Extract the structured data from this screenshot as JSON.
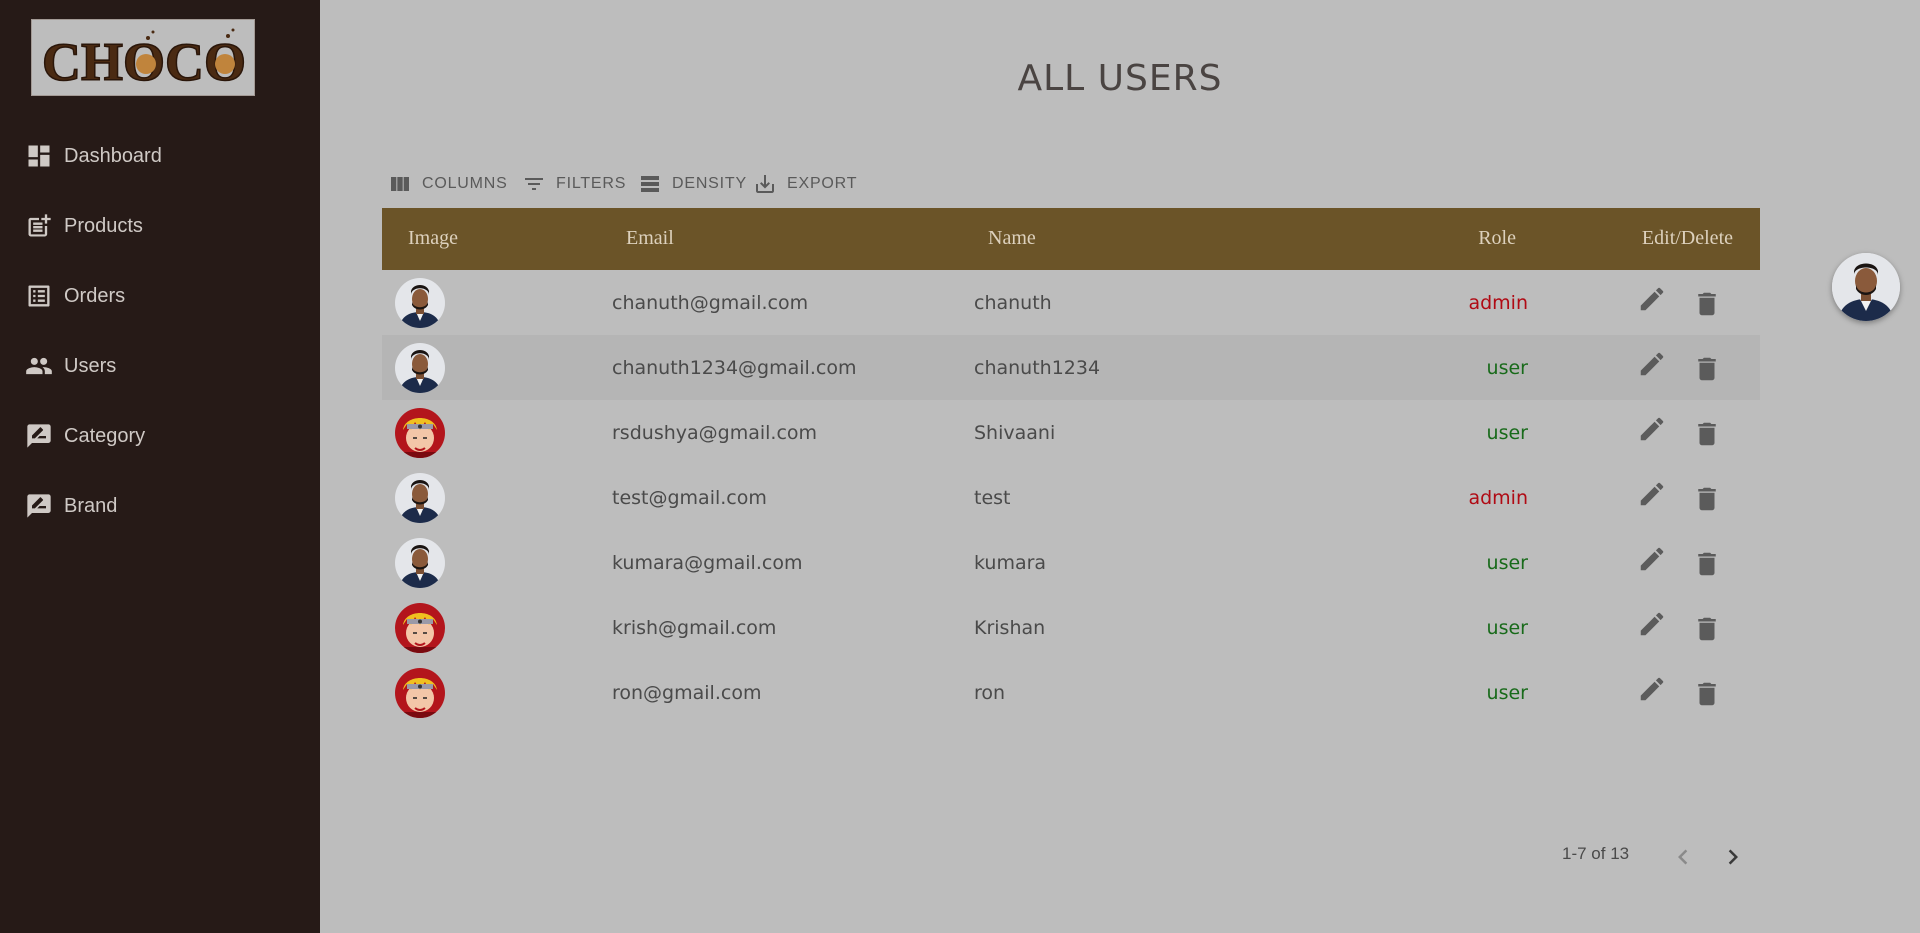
{
  "brand": {
    "logo_text": "CHOCO"
  },
  "sidebar": {
    "items": [
      {
        "label": "Dashboard",
        "icon": "dashboard-icon"
      },
      {
        "label": "Products",
        "icon": "post-add-icon"
      },
      {
        "label": "Orders",
        "icon": "list-alt-icon"
      },
      {
        "label": "Users",
        "icon": "people-icon"
      },
      {
        "label": "Category",
        "icon": "rate-review-icon"
      },
      {
        "label": "Brand",
        "icon": "rate-review-icon"
      }
    ]
  },
  "page": {
    "title": "ALL USERS"
  },
  "toolbar": {
    "columns": "COLUMNS",
    "filters": "FILTERS",
    "density": "DENSITY",
    "export": "EXPORT"
  },
  "grid": {
    "headers": {
      "image": "Image",
      "email": "Email",
      "name": "Name",
      "role": "Role",
      "actions": "Edit/Delete"
    },
    "rows": [
      {
        "avatar": "man-avatar",
        "email": "chanuth@gmail.com",
        "name": "chanuth",
        "role": "admin"
      },
      {
        "avatar": "man-avatar",
        "email": "chanuth1234@gmail.com",
        "name": "chanuth1234",
        "role": "user"
      },
      {
        "avatar": "anime-avatar",
        "email": "rsdushya@gmail.com",
        "name": "Shivaani",
        "role": "user"
      },
      {
        "avatar": "man-avatar",
        "email": "test@gmail.com",
        "name": "test",
        "role": "admin"
      },
      {
        "avatar": "man-avatar",
        "email": "kumara@gmail.com",
        "name": "kumara",
        "role": "user"
      },
      {
        "avatar": "anime-avatar",
        "email": "krish@gmail.com",
        "name": "Krishan",
        "role": "user"
      },
      {
        "avatar": "anime-avatar",
        "email": "ron@gmail.com",
        "name": "ron",
        "role": "user"
      }
    ]
  },
  "pagination": {
    "range": "1-7 of 13"
  },
  "colors": {
    "sidebar_bg": "#261a17",
    "header_bg": "#6b5428",
    "admin": "#b00a14",
    "user": "#186a1a",
    "page_bg": "#bdbdbd"
  }
}
